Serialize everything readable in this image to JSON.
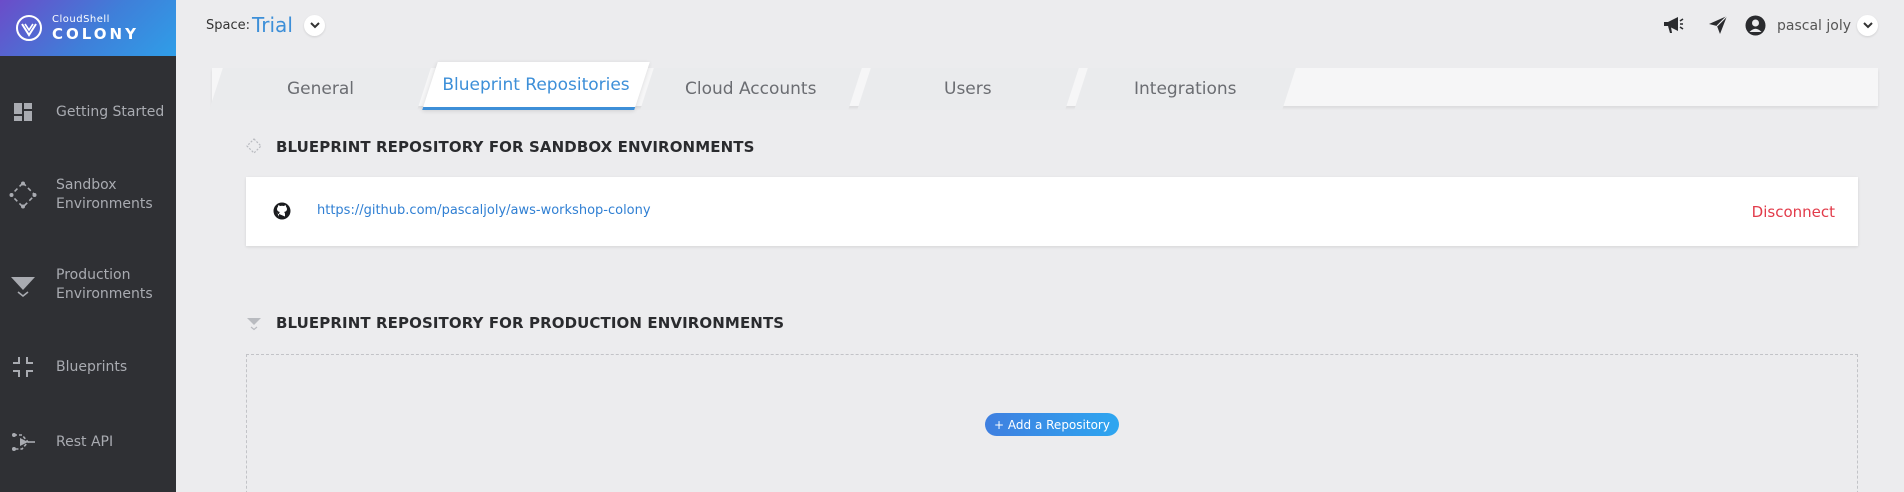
{
  "logo": {
    "small": "CloudShell",
    "big": "COLONY"
  },
  "nav": [
    {
      "label": "Getting Started",
      "icon": "dashboard-icon"
    },
    {
      "label": "Sandbox Environments",
      "icon": "diamond-dots-icon"
    },
    {
      "label": "Production Environments",
      "icon": "funnel-icon"
    },
    {
      "label": "Blueprints",
      "icon": "brackets-icon"
    },
    {
      "label": "Rest API",
      "icon": "api-icon"
    }
  ],
  "header": {
    "space_label": "Space:",
    "space_value": "Trial",
    "user_name": "pascal joly"
  },
  "tabs": [
    {
      "label": "General",
      "active": false
    },
    {
      "label": "Blueprint Repositories",
      "active": true
    },
    {
      "label": "Cloud Accounts",
      "active": false
    },
    {
      "label": "Users",
      "active": false
    },
    {
      "label": "Integrations",
      "active": false
    }
  ],
  "sandbox": {
    "title": "BLUEPRINT REPOSITORY FOR SANDBOX ENVIRONMENTS",
    "repo_url": "https://github.com/pascaljoly/aws-workshop-colony",
    "disconnect_label": "Disconnect"
  },
  "production": {
    "title": "BLUEPRINT REPOSITORY FOR PRODUCTION ENVIRONMENTS",
    "add_button_label": "+ Add a Repository"
  },
  "colors": {
    "accent": "#3d8fd8",
    "danger": "#e23b4a",
    "sidebar": "#2f3034"
  }
}
